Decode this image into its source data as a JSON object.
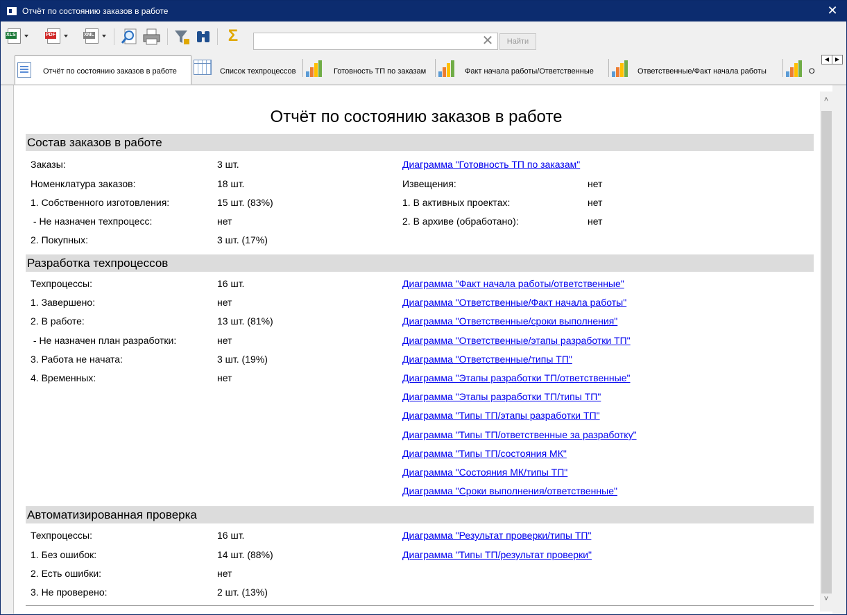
{
  "window": {
    "title": "Отчёт по состоянию заказов в работе",
    "close_glyph": "✕"
  },
  "toolbar": {
    "export_xls_tag": "XLS",
    "export_pdf_tag": "PDF",
    "export_xml_tag": "XML",
    "search_placeholder": "",
    "search_value": "",
    "clear_glyph": "✕",
    "find_label": "Найти",
    "sum_glyph": "Σ"
  },
  "tabs": [
    {
      "label": "Отчёт по состоянию заказов в работе",
      "icon": "report-icon",
      "active": true
    },
    {
      "label": "Список техпроцессов",
      "icon": "table-icon"
    },
    {
      "label": "Готовность ТП по заказам",
      "icon": "bar-chart-icon"
    },
    {
      "label": "Факт начала работы/Ответственные",
      "icon": "bar-chart-icon"
    },
    {
      "label": "Ответственные/Факт начала работы",
      "icon": "bar-chart-icon"
    },
    {
      "label": "О",
      "icon": "bar-chart-icon"
    }
  ],
  "tab_nav": {
    "prev_glyph": "◀",
    "next_glyph": "▶"
  },
  "report": {
    "title": "Отчёт по состоянию заказов в работе",
    "sections": {
      "orders": {
        "header": "Состав заказов в работе",
        "rows": [
          {
            "label": "Заказы:",
            "value": "3 шт."
          },
          {
            "label": "Номенклатура заказов:",
            "value": "18 шт."
          },
          {
            "label": "1. Собственного изготовления:",
            "value": "15 шт. (83%)"
          },
          {
            "label": " - Не назначен техпроцесс:",
            "value": "нет"
          },
          {
            "label": "2. Покупных:",
            "value": "3 шт. (17%)"
          }
        ],
        "link": "Диаграмма \"Готовность ТП по заказам\"",
        "notices": [
          {
            "label": "Извещения:",
            "value": "нет"
          },
          {
            "label": "1. В активных проектах:",
            "value": "нет"
          },
          {
            "label": "2. В архиве (обработано):",
            "value": "нет"
          }
        ]
      },
      "development": {
        "header": "Разработка техпроцессов",
        "rows": [
          {
            "label": "Техпроцессы:",
            "value": "16 шт."
          },
          {
            "label": "1. Завершено:",
            "value": "нет"
          },
          {
            "label": "2. В работе:",
            "value": "13 шт. (81%)"
          },
          {
            "label": " - Не назначен план разработки:",
            "value": "нет"
          },
          {
            "label": "3. Работа не начата:",
            "value": "3 шт. (19%)"
          },
          {
            "label": "4. Временных:",
            "value": "нет"
          }
        ],
        "links": [
          "Диаграмма \"Факт начала работы/ответственные\"",
          "Диаграмма \"Ответственные/Факт начала работы\"",
          "Диаграмма \"Ответственные/сроки выполнения\"",
          "Диаграмма \"Ответственные/этапы разработки ТП\"",
          "Диаграмма \"Ответственные/типы ТП\"",
          "Диаграмма \"Этапы разработки ТП/ответственные\"",
          "Диаграмма \"Этапы разработки ТП/типы ТП\"",
          "Диаграмма \"Типы ТП/этапы разработки ТП\"",
          "Диаграмма \"Типы ТП/ответственные за разработку\"",
          "Диаграмма \"Типы ТП/состояния МК\"",
          "Диаграмма \"Состояния МК/типы ТП\"",
          "Диаграмма \"Сроки выполнения/ответственные\""
        ]
      },
      "verification": {
        "header": "Автоматизированная проверка",
        "rows": [
          {
            "label": "Техпроцессы:",
            "value": "16 шт."
          },
          {
            "label": "1. Без ошибок:",
            "value": "14 шт. (88%)"
          },
          {
            "label": "2. Есть ошибки:",
            "value": "нет"
          },
          {
            "label": "3. Не проверено:",
            "value": "2 шт. (13%)"
          }
        ],
        "links": [
          "Диаграмма \"Результат проверки/типы ТП\"",
          "Диаграмма \"Типы ТП/результат проверки\""
        ]
      }
    }
  },
  "scrollbar": {
    "up_glyph": "˄",
    "down_glyph": "˅"
  },
  "colors": {
    "titlebar": "#0c2c6f",
    "link": "#0000ee",
    "section_header_bg": "#dcdcdc",
    "xls_tag": "#1e7a3a",
    "pdf_tag": "#d02a2a",
    "filter": "#6b7b8c",
    "binoculars": "#1f4f8f",
    "sum": "#e0a800"
  }
}
